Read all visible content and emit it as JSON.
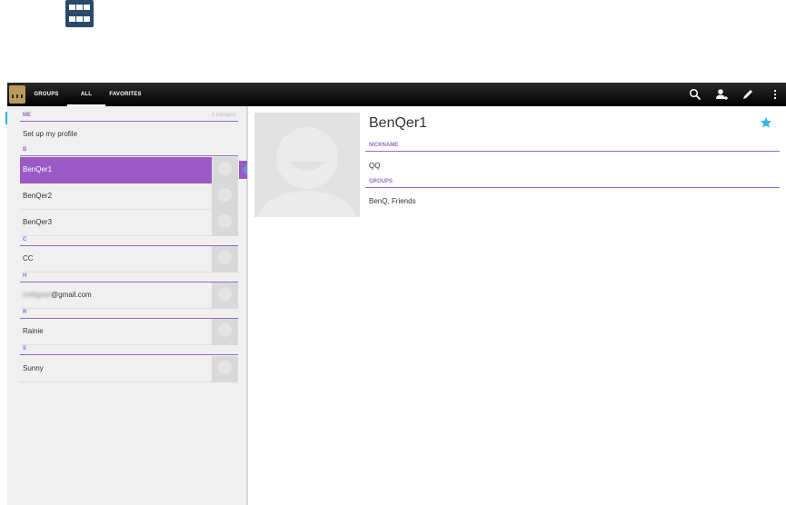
{
  "tabs": [
    {
      "label": "GROUPS"
    },
    {
      "label": "ALL"
    },
    {
      "label": "FAVORITES"
    }
  ],
  "sections": {
    "me": {
      "letter": "ME",
      "count": "1 contacts",
      "profile_label": "Set up my profile"
    },
    "b": {
      "letter": "B"
    },
    "c": {
      "letter": "C"
    },
    "h": {
      "letter": "H"
    },
    "r": {
      "letter": "R"
    },
    "s": {
      "letter": "S"
    }
  },
  "contacts": [
    {
      "name": "BenQer1",
      "selected": true
    },
    {
      "name": "BenQer2"
    },
    {
      "name": "BenQer3"
    },
    {
      "name": "CC"
    },
    {
      "name_hidden": "hotfigrad",
      "name_suffix": "@gmail.com"
    },
    {
      "name": "Rainie"
    },
    {
      "name": "Sunny"
    }
  ],
  "detail": {
    "name": "BenQer1",
    "nickname_header": "NICKNAME",
    "nickname": "QQ",
    "groups_header": "GROUPS",
    "groups": "BenQ, Friends",
    "favorite": true
  },
  "colors": {
    "accent": "#9b59c6",
    "header_line": "#8e6cc8",
    "star": "#33b5e5",
    "action_bar": "#000000"
  },
  "icons": [
    "apps-grid-icon",
    "contacts-app-icon",
    "search-icon",
    "add-contact-icon",
    "edit-icon",
    "overflow-menu-icon",
    "star-icon",
    "avatar-placeholder-icon"
  ]
}
